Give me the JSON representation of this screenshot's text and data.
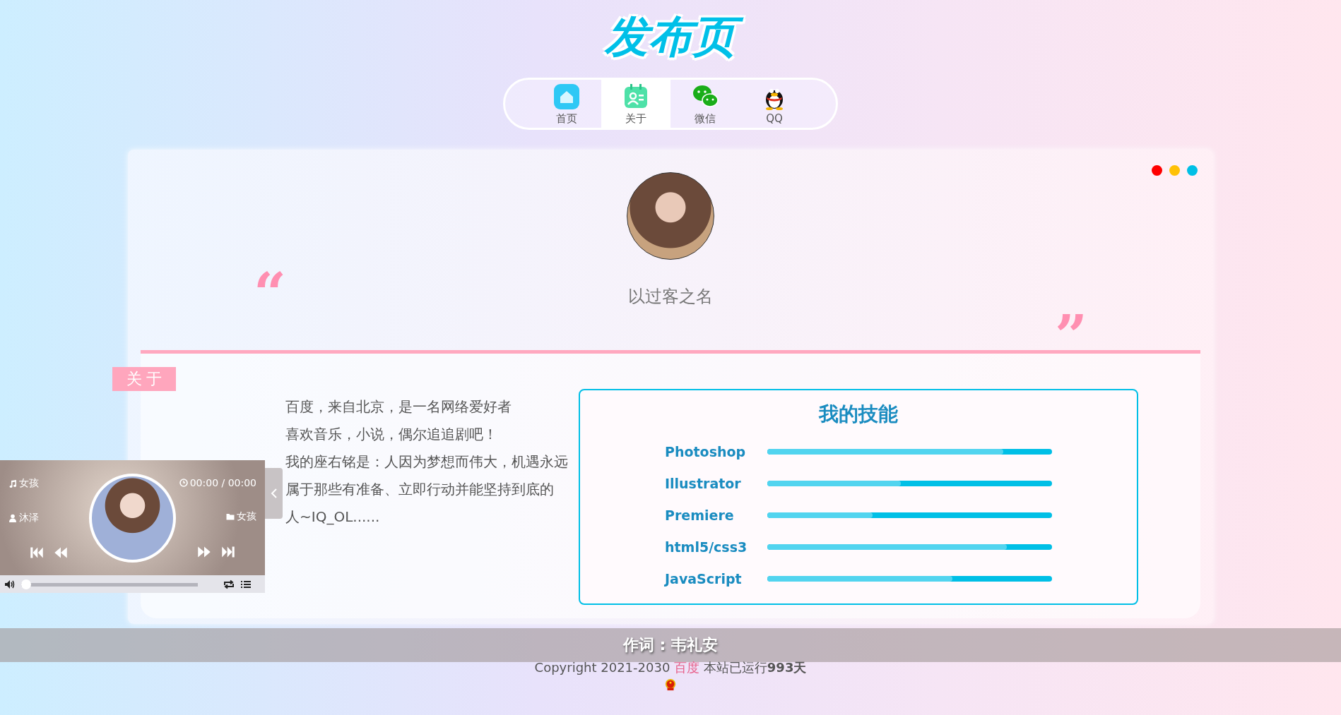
{
  "site_title": "发布页",
  "nav": [
    {
      "label": "首页",
      "kind": "home",
      "selected": false
    },
    {
      "label": "关于",
      "kind": "about",
      "selected": true
    },
    {
      "label": "微信",
      "kind": "wechat",
      "selected": false
    },
    {
      "label": "QQ",
      "kind": "qq",
      "selected": false
    }
  ],
  "window_dots": [
    {
      "color": "#ff0000"
    },
    {
      "color": "#ffc107"
    },
    {
      "color": "#00bfe6"
    }
  ],
  "profile": {
    "open_quote": "“",
    "name": "以过客之名",
    "close_quote": "”"
  },
  "about": {
    "tag": "关于",
    "lines": [
      "百度，来自北京，是一名网络爱好者",
      "喜欢音乐，小说，偶尔追追剧吧！",
      "我的座右铭是：人因为梦想而伟大，机遇永远",
      "属于那些有准备、立即行动并能坚持到底的",
      "人~IQ_OL......"
    ]
  },
  "skills": {
    "title": "我的技能",
    "items": [
      {
        "name": "Photoshop",
        "level": 0.83
      },
      {
        "name": "Illustrator",
        "level": 0.47
      },
      {
        "name": "Premiere",
        "level": 0.37
      },
      {
        "name": "html5/css3",
        "level": 0.84
      },
      {
        "name": "JavaScript",
        "level": 0.65
      }
    ]
  },
  "player": {
    "song": "女孩",
    "time": "00:00 / 00:00",
    "artist": "沐泽",
    "album": "女孩",
    "level": 0
  },
  "lyric": "作词 : 韦礼安",
  "footer": {
    "copyright": "Copyright 2021-2030",
    "link": "百度",
    "uptime": "本站已运行**993天**"
  }
}
